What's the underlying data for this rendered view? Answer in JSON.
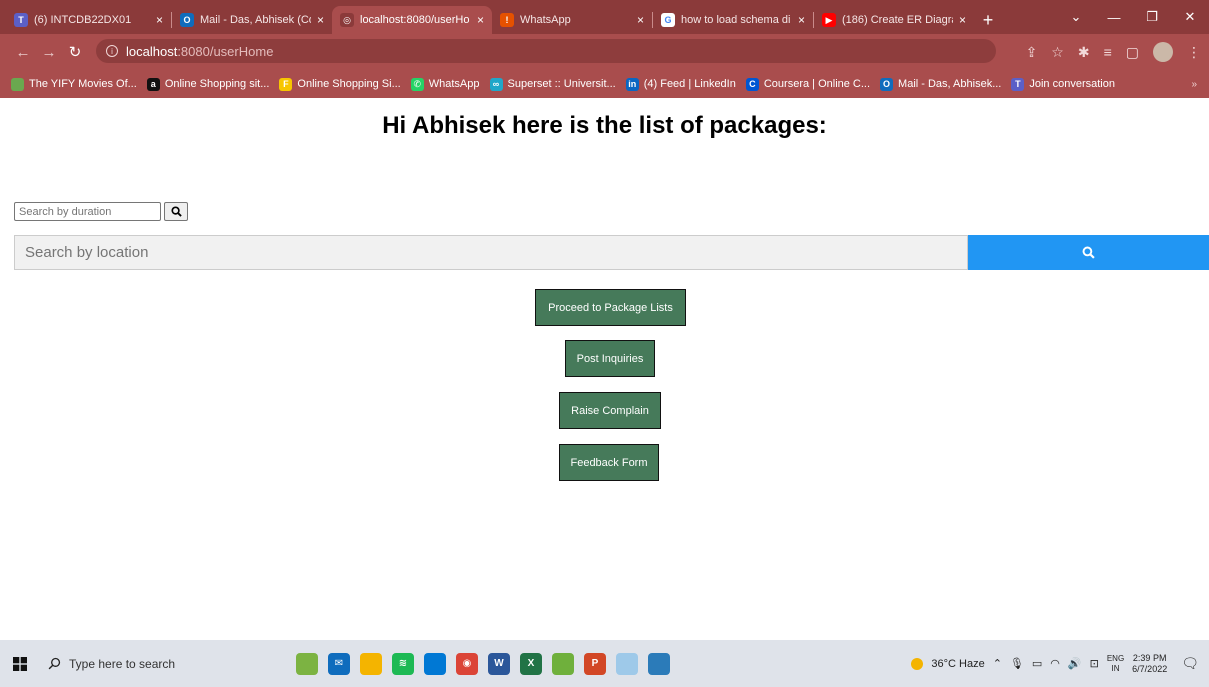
{
  "tabs": [
    {
      "label": "(6) INTCDB22DX01",
      "icon": "teams-icon",
      "color": "#5b5fc7",
      "glyph": "T",
      "active": false
    },
    {
      "label": "Mail - Das, Abhisek (Co",
      "icon": "outlook-icon",
      "color": "#0f6cbd",
      "glyph": "O",
      "active": false
    },
    {
      "label": "localhost:8080/userHo",
      "icon": "globe-icon",
      "color": "#8b3a3a",
      "glyph": "◎",
      "active": true
    },
    {
      "label": "WhatsApp",
      "icon": "whatsapp-icon",
      "color": "#e65100",
      "glyph": "!",
      "active": false
    },
    {
      "label": "how to load schema di",
      "icon": "google-icon",
      "color": "#ffffff",
      "glyph": "G",
      "active": false
    },
    {
      "label": "(186) Create ER Diagra",
      "icon": "youtube-icon",
      "color": "#ff0000",
      "glyph": "▶",
      "active": false
    }
  ],
  "address_bar": {
    "host": "localhost",
    "path": ":8080/userHome"
  },
  "bookmarks": [
    {
      "label": "The YIFY Movies Of...",
      "icon": "yify-icon",
      "color": "#6aa84f",
      "glyph": ""
    },
    {
      "label": "Online Shopping sit...",
      "icon": "amazon-icon",
      "color": "#111111",
      "glyph": "a"
    },
    {
      "label": "Online Shopping Si...",
      "icon": "flipkart-icon",
      "color": "#f7c600",
      "glyph": "F"
    },
    {
      "label": "WhatsApp",
      "icon": "whatsapp-icon",
      "color": "#25d366",
      "glyph": "✆"
    },
    {
      "label": "Superset :: Universit...",
      "icon": "superset-icon",
      "color": "#20a7c9",
      "glyph": "∞"
    },
    {
      "label": "(4) Feed | LinkedIn",
      "icon": "linkedin-icon",
      "color": "#0a66c2",
      "glyph": "in"
    },
    {
      "label": "Coursera | Online C...",
      "icon": "coursera-icon",
      "color": "#0056d2",
      "glyph": "C"
    },
    {
      "label": "Mail - Das, Abhisek...",
      "icon": "outlook-icon",
      "color": "#0f6cbd",
      "glyph": "O"
    },
    {
      "label": "Join conversation",
      "icon": "teams-icon",
      "color": "#5b5fc7",
      "glyph": "T"
    }
  ],
  "bookmarks_more": "»",
  "page": {
    "title": "Hi Abhisek here is the list of packages:",
    "duration_placeholder": "Search by duration",
    "location_placeholder": "Search by location",
    "buttons": {
      "packages": "Proceed to Package Lists",
      "inquiries": "Post Inquiries",
      "complain": "Raise Complain",
      "feedback": "Feedback Form"
    }
  },
  "taskbar": {
    "search_placeholder": "Type here to search",
    "apps": [
      {
        "icon": "widgets-icon",
        "color": "#7cb342",
        "glyph": ""
      },
      {
        "icon": "mail-app-icon",
        "color": "#0f6cbd",
        "glyph": "✉"
      },
      {
        "icon": "file-explorer-icon",
        "color": "#f4b400",
        "glyph": ""
      },
      {
        "icon": "spotify-icon",
        "color": "#1db954",
        "glyph": "≋"
      },
      {
        "icon": "store-icon",
        "color": "#0078d4",
        "glyph": ""
      },
      {
        "icon": "chrome-icon",
        "color": "#db4437",
        "glyph": "◉"
      },
      {
        "icon": "word-icon",
        "color": "#2b579a",
        "glyph": "W"
      },
      {
        "icon": "excel-icon",
        "color": "#217346",
        "glyph": "X"
      },
      {
        "icon": "eclipse-icon",
        "color": "#6fb03c",
        "glyph": ""
      },
      {
        "icon": "powerpoint-icon",
        "color": "#d24726",
        "glyph": "P"
      },
      {
        "icon": "paint-icon",
        "color": "#9ec9e9",
        "glyph": ""
      },
      {
        "icon": "vscode-icon",
        "color": "#2b7bb9",
        "glyph": ""
      }
    ],
    "weather": "36°C  Haze",
    "lang_top": "ENG",
    "lang_bottom": "IN",
    "time": "2:39 PM",
    "date": "6/7/2022"
  }
}
